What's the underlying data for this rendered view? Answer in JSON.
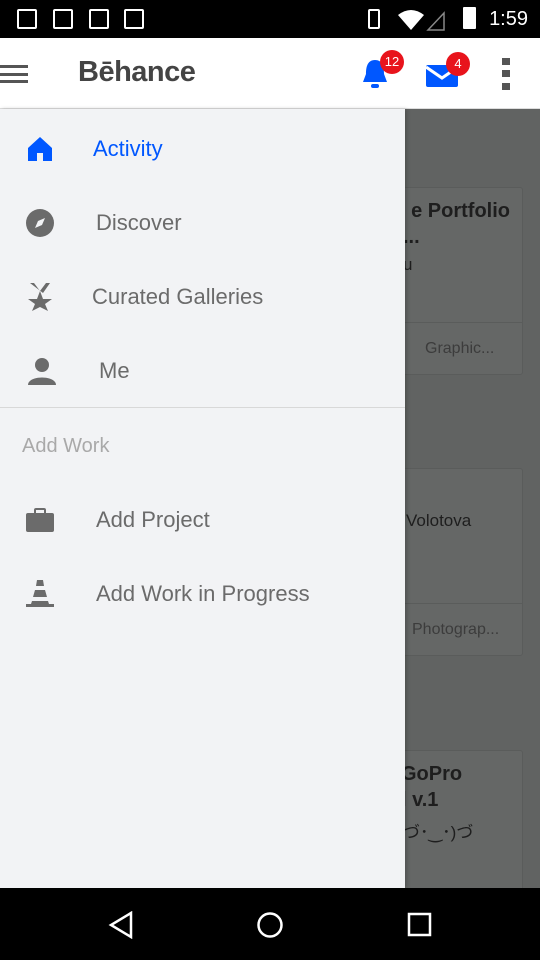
{
  "status_bar": {
    "time": "1:59",
    "icons": [
      "gmail-icon",
      "inbox-check-icon",
      "image-icon",
      "play-store-icon",
      "vibrate-icon",
      "wifi-icon",
      "signal-icon",
      "battery-icon"
    ]
  },
  "app_bar": {
    "logo": "Bēhance",
    "notifications_count": "12",
    "messages_count": "4",
    "accent": "#0057ff"
  },
  "drawer": {
    "items": [
      {
        "label": "Activity",
        "icon": "home-icon",
        "active": true
      },
      {
        "label": "Discover",
        "icon": "compass-icon"
      },
      {
        "label": "Curated Galleries",
        "icon": "ribbon-star-icon"
      },
      {
        "label": "Me",
        "icon": "person-icon"
      }
    ],
    "section_title": "Add Work",
    "work_items": [
      {
        "label": "Add Project",
        "icon": "briefcase-icon"
      },
      {
        "label": "Add Work in Progress",
        "icon": "traffic-cone-icon"
      }
    ]
  },
  "background_cards": [
    {
      "title_line1": "e Portfolio",
      "title_line2": "...",
      "author": "u",
      "field": "Graphic..."
    },
    {
      "author": "Volotova",
      "field": "Photograp..."
    },
    {
      "title_line1": "GoPro",
      "title_line2": "l v.1",
      "author": "づ･‿･)づ"
    }
  ]
}
